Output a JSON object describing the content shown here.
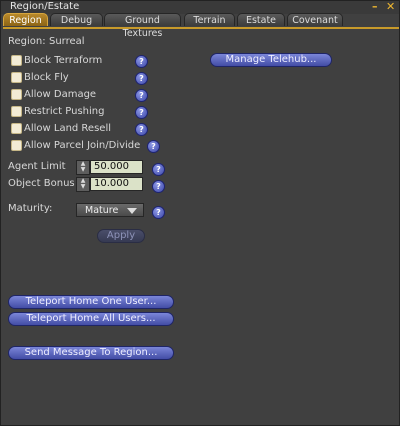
{
  "window": {
    "title": "Region/Estate",
    "minimize_glyph": "–",
    "close_glyph": "✕"
  },
  "tabs": [
    {
      "label": "Region",
      "active": true
    },
    {
      "label": "Debug"
    },
    {
      "label": "Ground Textures"
    },
    {
      "label": "Terrain"
    },
    {
      "label": "Estate"
    },
    {
      "label": "Covenant"
    }
  ],
  "region": {
    "label": "Region:",
    "value": "Surreal"
  },
  "checkboxes": [
    {
      "label": "Block Terraform",
      "checked": false
    },
    {
      "label": "Block Fly",
      "checked": false
    },
    {
      "label": "Allow Damage",
      "checked": false
    },
    {
      "label": "Restrict Pushing",
      "checked": false
    },
    {
      "label": "Allow Land Resell",
      "checked": false
    },
    {
      "label": "Allow Parcel Join/Divide",
      "checked": false
    }
  ],
  "help_glyph": "?",
  "buttons": {
    "manage_telehub": "Manage Telehub...",
    "apply": "Apply",
    "teleport_one": "Teleport Home One User...",
    "teleport_all": "Teleport Home All Users...",
    "send_message": "Send Message To Region..."
  },
  "agent_limit": {
    "label": "Agent Limit",
    "value": "50.000"
  },
  "object_bonus": {
    "label": "Object Bonus",
    "value": "10.000"
  },
  "maturity": {
    "label": "Maturity:",
    "value": "Mature"
  },
  "spinner": {
    "up": "▲",
    "down": "▼"
  },
  "colors": {
    "accent": "#c89a2a",
    "button": "#5b65c4",
    "panel": "#404040"
  }
}
